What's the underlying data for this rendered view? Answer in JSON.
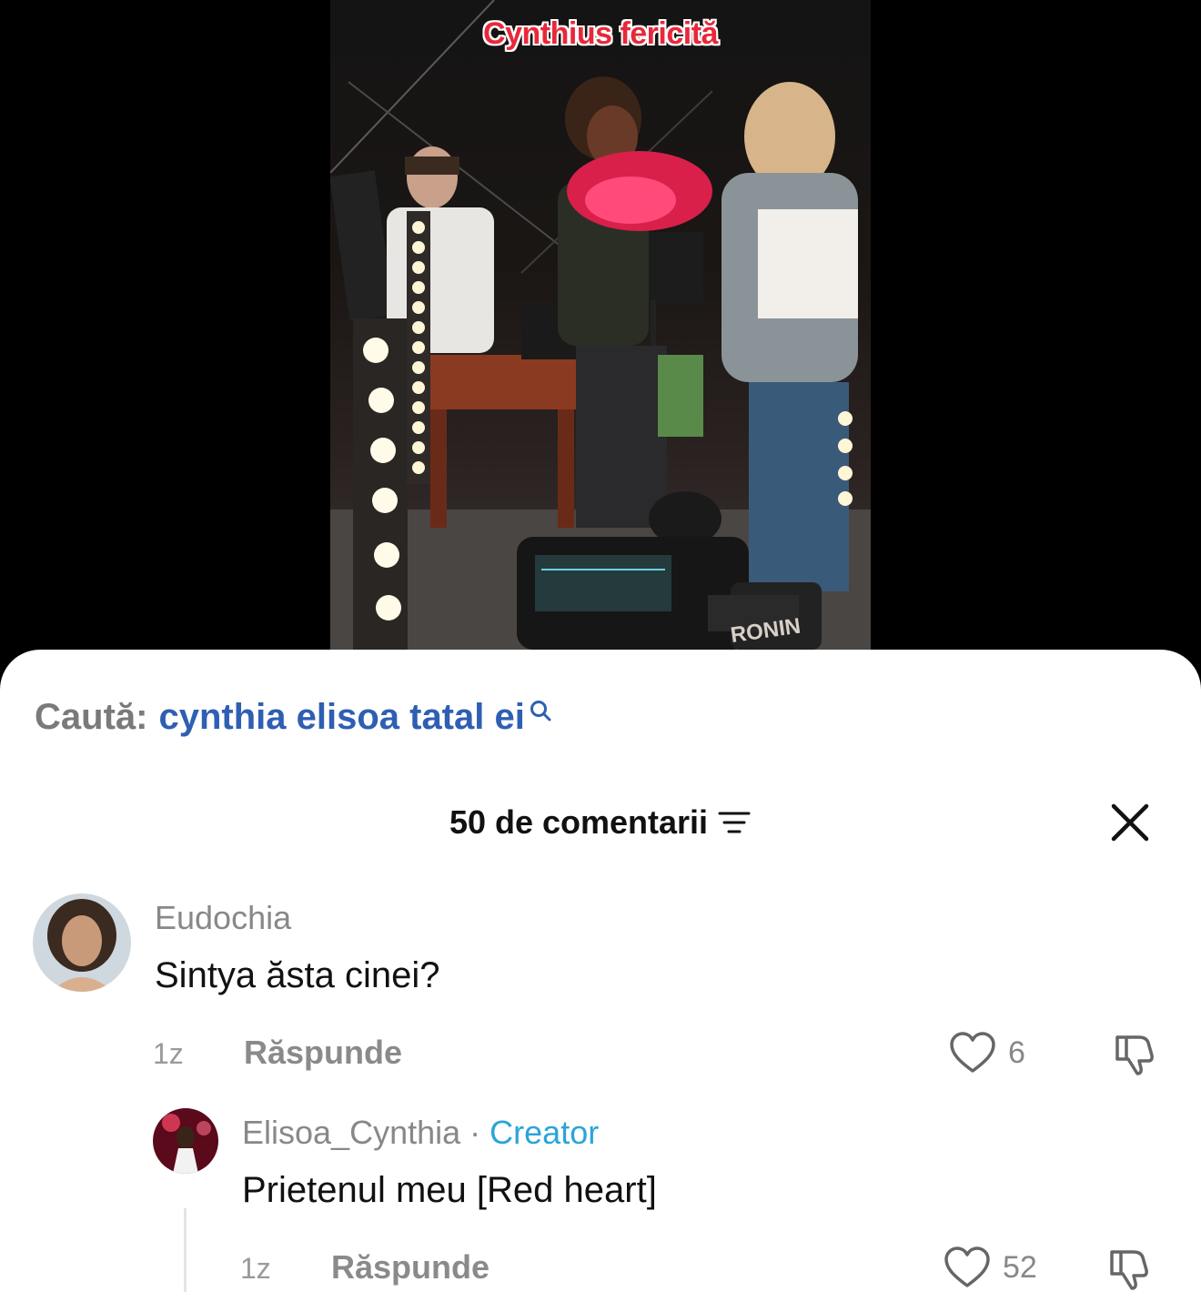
{
  "video": {
    "overlay_text": "Cynthius fericită",
    "camera_label": "RONIN"
  },
  "search": {
    "prefix": "Caută:",
    "query": "cynthia elisoa tatal ei"
  },
  "comments_header": {
    "count_label": "50 de comentarii"
  },
  "comments": [
    {
      "username": "Eudochia",
      "text": "Sintya ăsta cinei?",
      "time": "1z",
      "reply_label": "Răspunde",
      "likes": "6"
    }
  ],
  "replies": [
    {
      "username": "Elisoa_Cynthia",
      "separator": "·",
      "badge": "Creator",
      "text": "Prietenul meu [Red heart]",
      "time": "1z",
      "reply_label": "Răspunde",
      "likes": "52"
    }
  ],
  "icons": {
    "search": "search-icon",
    "filter": "filter-icon",
    "close": "close-icon",
    "like": "heart-outline-icon",
    "dislike": "thumbs-down-icon"
  },
  "colors": {
    "search_query": "#2f5fb3",
    "creator_badge": "#2aa5d8",
    "overlay_text": "#e8283a"
  }
}
